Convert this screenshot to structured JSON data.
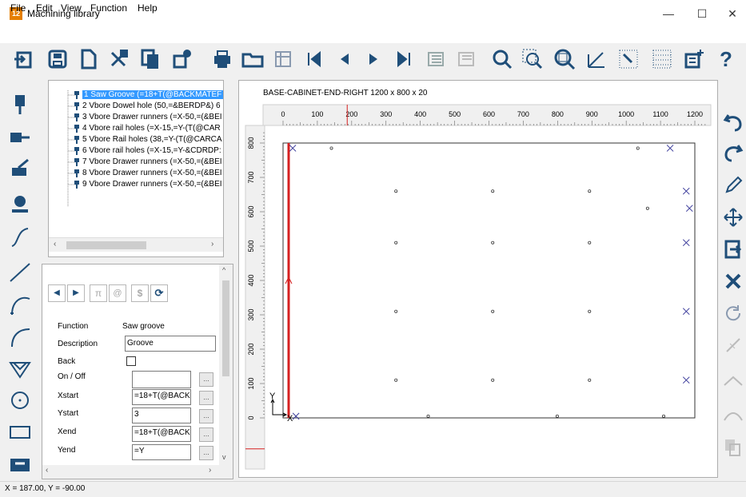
{
  "window": {
    "title": "Machining library",
    "app_icon_text": "12",
    "minimize": "—",
    "maximize": "☐",
    "close": "✕"
  },
  "menu": [
    "File",
    "Edit",
    "View",
    "Function",
    "Help"
  ],
  "toolbar": {
    "icons": [
      "import-icon",
      "save-icon",
      "new-icon",
      "cut-icon",
      "copy-icon",
      "settings-icon",
      "print-icon",
      "folder-icon",
      "save-as-icon",
      "first-icon",
      "previous-icon",
      "next-icon",
      "last-icon",
      "layer-icon",
      "layer-off-icon",
      "zoom-icon",
      "zoom-window-icon",
      "zoom-fit-icon",
      "measure-icon",
      "grid-select-icon",
      "grid-icon",
      "properties-icon",
      "help-icon"
    ],
    "help_text": "?"
  },
  "tree": {
    "items": [
      {
        "label": "1 Saw Groove (=18+T(@BACKMATEF",
        "selected": true
      },
      {
        "label": "2 Vbore Dowel hole (50,=&BERDP&) 6",
        "selected": false
      },
      {
        "label": "3 Vbore Drawer runners (=X-50,=(&BEI",
        "selected": false
      },
      {
        "label": "4 Vbore rail holes (=X-15,=Y-(T(@CAR",
        "selected": false
      },
      {
        "label": "5 Vbore Rail holes (38,=Y-(T(@CARCA",
        "selected": false
      },
      {
        "label": "6 Vbore rail holes (=X-15,=Y-&CDRDP:",
        "selected": false
      },
      {
        "label": "7 Vbore Drawer runners (=X-50,=(&BEI",
        "selected": false
      },
      {
        "label": "8 Vbore Drawer runners (=X-50,=(&BEI",
        "selected": false
      },
      {
        "label": "9 Vbore Drawer runners (=X-50,=(&BEI",
        "selected": false
      }
    ]
  },
  "props": {
    "nav_icons": [
      "◀",
      "▶",
      "π",
      "@",
      "$",
      "⟳"
    ],
    "fields": [
      {
        "label": "Function",
        "value": "Saw groove",
        "type": "text"
      },
      {
        "label": "Description",
        "value": "Groove",
        "type": "input"
      },
      {
        "label": "Back",
        "value": "",
        "type": "checkbox"
      },
      {
        "label": "On / Off",
        "value": "",
        "type": "inputbtn"
      },
      {
        "label": "Xstart",
        "value": "=18+T(@BACK",
        "type": "inputbtn"
      },
      {
        "label": "Ystart",
        "value": "3",
        "type": "inputbtn"
      },
      {
        "label": "Xend",
        "value": "=18+T(@BACK",
        "type": "inputbtn"
      },
      {
        "label": "Yend",
        "value": "=Y",
        "type": "inputbtn"
      }
    ],
    "ellipsis": "..."
  },
  "canvas": {
    "header": "BASE-CABINET-END-RIGHT   1200 x 800 x 20",
    "x_ticks": [
      "0",
      "100",
      "200",
      "300",
      "400",
      "500",
      "600",
      "700",
      "800",
      "900",
      "1000",
      "1100",
      "1200"
    ],
    "y_ticks": [
      "0",
      "100",
      "200",
      "300",
      "400",
      "500",
      "600",
      "700",
      "800"
    ],
    "axis_y": "Y",
    "axis_x": "X",
    "holes_circle": [
      [
        150,
        785
      ],
      [
        450,
        5
      ],
      [
        850,
        5
      ],
      [
        1180,
        5
      ],
      [
        350,
        660
      ],
      [
        650,
        660
      ],
      [
        950,
        660
      ],
      [
        350,
        510
      ],
      [
        650,
        510
      ],
      [
        950,
        510
      ],
      [
        350,
        310
      ],
      [
        650,
        310
      ],
      [
        950,
        310
      ],
      [
        350,
        110
      ],
      [
        650,
        110
      ],
      [
        950,
        110
      ],
      [
        1100,
        785
      ],
      [
        1130,
        610
      ]
    ],
    "holes_x": [
      [
        30,
        785
      ],
      [
        1200,
        785
      ],
      [
        1250,
        660
      ],
      [
        1250,
        510
      ],
      [
        1250,
        310
      ],
      [
        1250,
        110
      ],
      [
        1260,
        610
      ],
      [
        40,
        5
      ]
    ]
  },
  "status": {
    "text": "X = 187.00, Y = -90.00"
  }
}
